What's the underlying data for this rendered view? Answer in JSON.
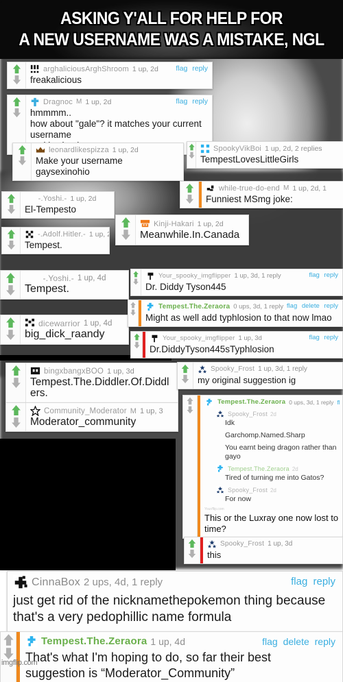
{
  "meme": {
    "caption_line1": "ASKING Y'ALL FOR HELP FOR",
    "caption_line2": "A NEW USERNAME WAS A MISTAKE, NGL",
    "watermark": "imgflip.com"
  },
  "colors": {
    "upvote_green": "#5cb85c",
    "downvote_gray": "#b0b0b0",
    "link_blue": "#3aaee0",
    "op_name_green": "#6ab04c",
    "op_stripe_orange": "#f0891e",
    "reply_stripe_red": "#e02020",
    "username_gray": "#9a9a9a"
  },
  "comments": [
    {
      "id": "c1",
      "user": "arghaliciousArghShroom",
      "avatar": "dots-avatar",
      "mod": "",
      "stats": "1 up, 2d",
      "actions": [
        "flag",
        "reply"
      ],
      "text": "freakalicious"
    },
    {
      "id": "c2",
      "user": "Dragnoc",
      "avatar": "cross-avatar",
      "mod": "M",
      "stats": "1 up, 2d",
      "actions": [
        "flag",
        "reply"
      ],
      "text": "hmmmm..\nhow about \"gale\"? it matches your current username\nand is simple"
    },
    {
      "id": "c3",
      "user": "leonardlikespizza",
      "avatar": "crown-avatar",
      "mod": "",
      "stats": "1 up, 2d",
      "actions": [],
      "text": "Make your username gaysexinohio"
    },
    {
      "id": "c4",
      "user": "SpookyVikBoi",
      "avatar": "blue-squares-avatar",
      "mod": "",
      "stats": "1 up, 2d, 2 replies",
      "actions": [],
      "text": "TempestLovesLittleGirls"
    },
    {
      "id": "c5",
      "user": "while-true-do-end",
      "avatar": "pixel-boot-avatar",
      "mod": "M",
      "stats": "1 up, 2d, 1",
      "actions": [],
      "text": "Funniest MSmg joke:"
    },
    {
      "id": "c6",
      "user": "-.Yoshi.-",
      "avatar": "",
      "mod": "",
      "stats": "1 up, 2d",
      "actions": [],
      "text": "El-Tempesto"
    },
    {
      "id": "c7",
      "user": "-.Adolf.Hitler.-",
      "avatar": "pixel-swastika-avatar",
      "mod": "",
      "stats": "1 up, 2",
      "actions": [],
      "text": "Tempest."
    },
    {
      "id": "c8",
      "user": "Kinji-Hakari",
      "avatar": "orange-pixel-avatar",
      "mod": "",
      "stats": "1 up, 2d",
      "actions": [],
      "text": "Meanwhile.In.Canada"
    },
    {
      "id": "c9",
      "user": "-.Yoshi.-",
      "avatar": "",
      "mod": "",
      "stats": "1 up, 4d",
      "actions": [],
      "text": "Tempest."
    },
    {
      "id": "c10",
      "user": "dicewarrior",
      "avatar": "pixel-dice-avatar",
      "mod": "",
      "stats": "1 up, 4d",
      "actions": [],
      "text": "big_dick_raandy"
    },
    {
      "id": "c11",
      "user": "Your_spooky_imgflipper",
      "avatar": "pixel-flag-avatar",
      "mod": "",
      "stats": "1 up, 3d, 1 reply",
      "actions": [
        "flag",
        "reply"
      ],
      "text": "Dr. Diddy Tyson445"
    },
    {
      "id": "c12",
      "user": "Tempest.The.Zeraora",
      "avatar": "zeraora-avatar",
      "mod": "",
      "stats": "0 ups, 3d, 1 reply",
      "actions": [
        "flag",
        "delete",
        "reply"
      ],
      "text": "Might as well add typhlosion to that now lmao"
    },
    {
      "id": "c13",
      "user": "Your_spooky_imgflipper",
      "avatar": "pixel-flag-avatar",
      "mod": "",
      "stats": "1 up, 3d",
      "actions": [
        "flag",
        "reply"
      ],
      "text": "Dr.DiddyTyson445sTyphlosion"
    },
    {
      "id": "c14",
      "user": "bingxbangxBOO",
      "avatar": "pixel-ghost-avatar",
      "mod": "",
      "stats": "1 up, 3d",
      "actions": [],
      "text": "Tempest.The.Diddler.Of.Diddlers."
    },
    {
      "id": "c15",
      "user": "Community_Moderator",
      "avatar": "star-avatar",
      "mod": "M",
      "stats": "1 up, 3",
      "actions": [],
      "text": "Moderator_community"
    },
    {
      "id": "c16",
      "user": "Spooky_Frost",
      "avatar": "stars-avatar",
      "mod": "",
      "stats": "1 up, 3d, 1 reply",
      "actions": [],
      "text": "my original suggestion ig"
    },
    {
      "id": "c17",
      "user": "Tempest.The.Zeraora",
      "avatar": "zeraora-avatar",
      "mod": "",
      "stats": "0 ups, 3d, 1 reply",
      "actions": [
        "fl"
      ],
      "text": "",
      "nested": [
        {
          "user": "Spooky_Frost",
          "avatar": "stars-avatar",
          "time": "2d",
          "lines": [
            "Idk",
            "Garchomp.Named.Sharp",
            "You earnt being dragon rather than gayo"
          ]
        },
        {
          "user": "Tempest.The.Zeraora",
          "avatar": "zeraora-avatar",
          "time": "2d",
          "green": true,
          "lines": [
            "Tired of turning me into Gatos?"
          ]
        },
        {
          "user": "Spooky_Frost",
          "avatar": "stars-avatar",
          "time": "2d",
          "lines": [
            "For now"
          ]
        }
      ],
      "tiny_tag": "Your/flip.com",
      "closing_text": "This or the Luxray one now lost to time?"
    },
    {
      "id": "c18",
      "user": "Spooky_Frost",
      "avatar": "stars-avatar",
      "mod": "",
      "stats": "1 up, 3d",
      "actions": [],
      "text": "this"
    },
    {
      "id": "c19",
      "user": "CinnaBox",
      "avatar": "pixel-plus-avatar",
      "mod": "",
      "stats": "2 ups, 4d, 1 reply",
      "actions": [
        "flag",
        "reply"
      ],
      "text": "just get rid of the nicknamethepokemon thing because\nthat's a very pedophillic name formula"
    },
    {
      "id": "c20",
      "user": "Tempest.The.Zeraora",
      "avatar": "zeraora-avatar",
      "mod": "",
      "stats": "1 up, 4d",
      "actions": [
        "flag",
        "delete",
        "reply"
      ],
      "text": "That's what I'm hoping to do, so far their best\nsuggestion is “Moderator_Community”"
    }
  ]
}
